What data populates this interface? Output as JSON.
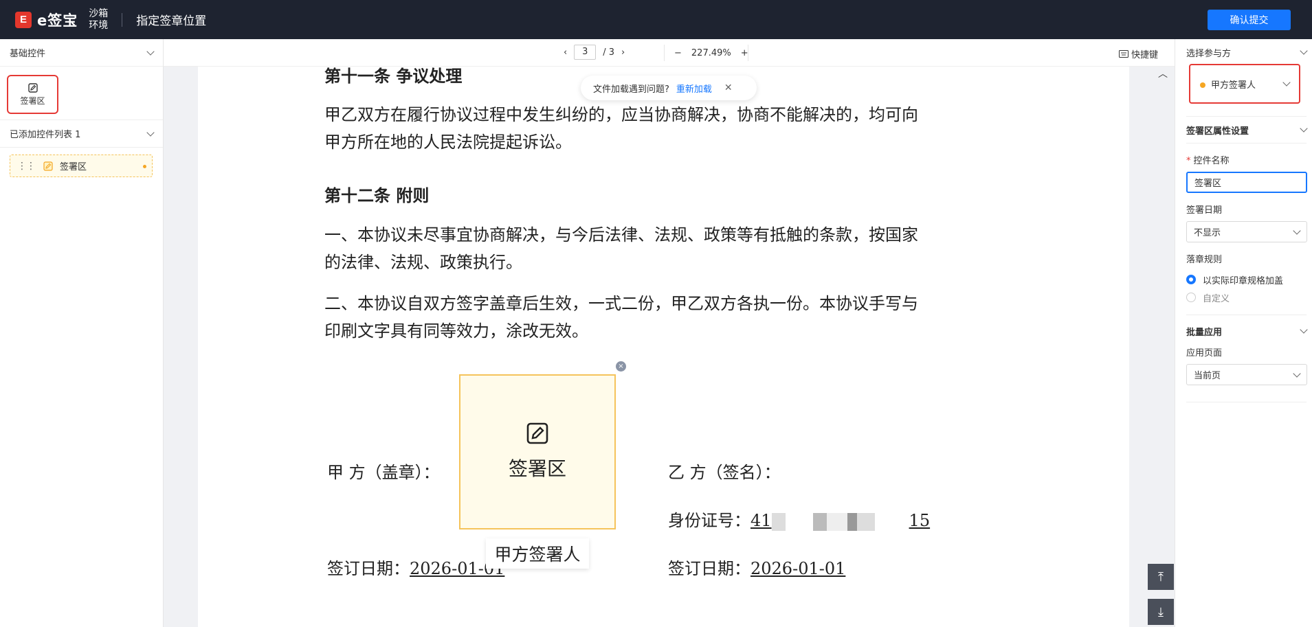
{
  "header": {
    "logo_mark": "E",
    "logo_text": "e签宝",
    "env_line1": "沙箱",
    "env_line2": "环境",
    "title": "指定签章位置",
    "confirm_label": "确认提交"
  },
  "left": {
    "basic_controls_label": "基础控件",
    "control_tile_label": "签署区",
    "added_list_label": "已添加控件列表 1",
    "added_items": [
      {
        "label": "签署区"
      }
    ]
  },
  "toolbar": {
    "prev": "‹",
    "current_page": "3",
    "total_pages": "/ 3",
    "next": "›",
    "zoom_out": "−",
    "zoom": "227.49%",
    "zoom_in": "+",
    "shortcut_label": "快捷键"
  },
  "toast": {
    "text": "文件加载遇到问题?",
    "link": "重新加载",
    "close": "✕"
  },
  "document": {
    "h11": "第十一条 争议处理",
    "p11_1": "甲乙双方在履行协议过程中发生纠纷的，应当协商解决，协商不能解决的，均可向",
    "p11_2": "甲方所在地的人民法院提起诉讼。",
    "h12": "第十二条 附则",
    "p12a_1": "一、本协议未尽事宜协商解决，与今后法律、法规、政策等有抵触的条款，按国家",
    "p12a_2": "的法律、法规、政策执行。",
    "p12b_1": "二、本协议自双方签字盖章后生效，一式二份，甲乙双方各执一份。本协议手写与",
    "p12b_2": "印刷文字具有同等效力，涂改无效。",
    "party_a_label": "甲 方（盖章）：",
    "party_b_label": "乙 方（签名）：",
    "id_label": "身份证号：",
    "id_prefix": "41",
    "id_suffix": "15",
    "date_label": "签订日期：",
    "date_a": "2026-01-01",
    "date_b": "2026-01-01"
  },
  "sign_box": {
    "label": "签署区",
    "close": "×",
    "signer_tag": "甲方签署人"
  },
  "right": {
    "select_party_label": "选择参与方",
    "selected_signer": "甲方签署人",
    "props_label": "签署区属性设置",
    "name_label": "控件名称",
    "name_value": "签署区",
    "date_label": "签署日期",
    "date_value": "不显示",
    "rule_label": "落章规则",
    "rule_options": [
      "以实际印章规格加盖",
      "自定义"
    ],
    "batch_label": "批量应用",
    "apply_pages_label": "应用页面",
    "apply_pages_value": "当前页"
  },
  "nav": {
    "top": "⤒",
    "bottom": "⤓"
  },
  "colors": {
    "header_bg": "#1e2330",
    "accent": "#1677ff",
    "highlight": "#e53935",
    "sign_fill": "#fffbea",
    "sign_border": "#f5c35a"
  }
}
